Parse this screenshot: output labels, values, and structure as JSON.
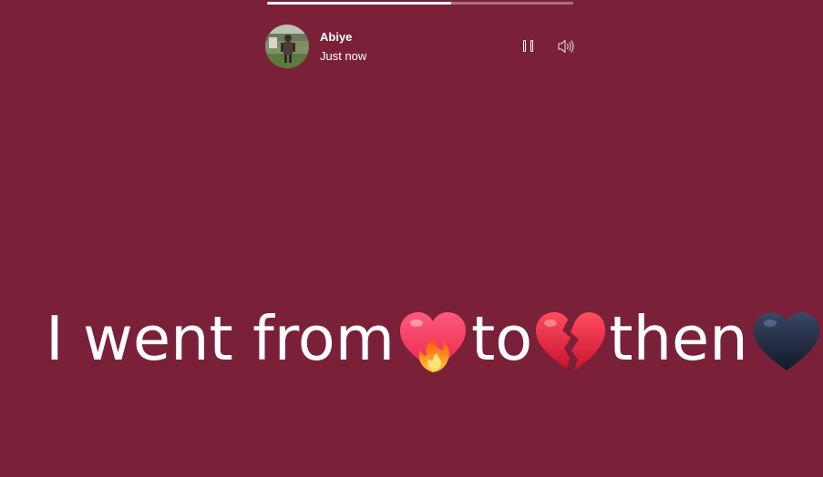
{
  "story": {
    "background_color": "#7a2139",
    "progress": 0.6,
    "author": {
      "name": "Abiye",
      "time": "Just now"
    },
    "controls": {
      "pause_icon": "pause-icon",
      "volume_icon": "speaker-icon"
    },
    "text": {
      "part1": "I went from",
      "emoji1": "heart-on-fire",
      "part2": "to",
      "emoji2": "broken-heart",
      "part3": "then",
      "emoji3": "black-heart"
    }
  }
}
